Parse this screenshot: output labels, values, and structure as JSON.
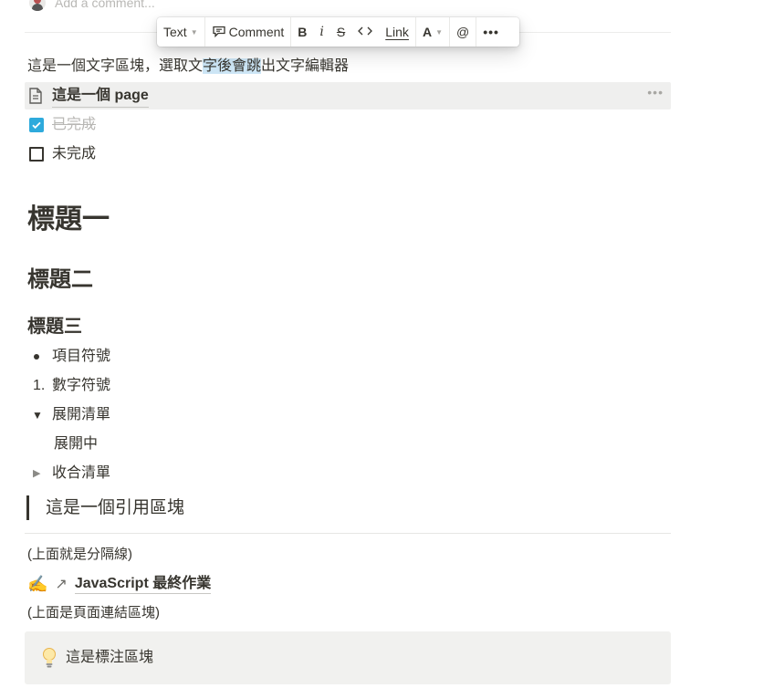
{
  "comment": {
    "placeholder": "Add a comment..."
  },
  "toolbar": {
    "turn_into": "Text",
    "comment": "Comment",
    "bold": "B",
    "italic": "i",
    "strike": "S",
    "link": "Link",
    "color": "A",
    "mention": "@",
    "more": "•••"
  },
  "blocks": {
    "text_before": "這是一個文字區塊，選取文",
    "text_selected": "字後會跳",
    "text_after": "出文字編輯器",
    "page_link": "這是一個 page",
    "page_more": "•••",
    "todo_done": "已完成",
    "todo_open": "未完成",
    "heading1": "標題一",
    "heading2": "標題二",
    "heading3": "標題三",
    "bulleted": "項目符號",
    "numbered_marker": "1.",
    "numbered": "數字符號",
    "toggle_open": "展開清單",
    "toggle_child": "展開中",
    "toggle_closed": "收合清單",
    "quote": "這是一個引用區塊",
    "divider_note": "(上面就是分隔線)",
    "link_emoji": "✍️",
    "link_arrow": "↗",
    "link_title": "JavaScript 最終作業",
    "link_note": "(上面是頁面連結區塊)",
    "callout_emoji": "💡",
    "callout": "這是標注區塊"
  }
}
